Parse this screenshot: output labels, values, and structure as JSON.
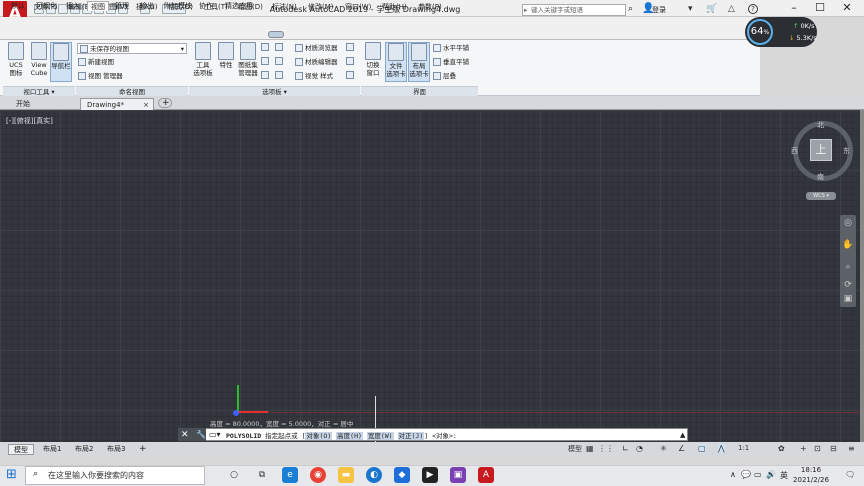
{
  "titlebar": {
    "app_letter": "A",
    "title": "Autodesk AutoCAD 2019 - 学生版    Drawing4.dwg",
    "search_placeholder": "键入关键字或短语",
    "login": "登录",
    "help": "?"
  },
  "menus": [
    "文件(F)",
    "编辑(E)",
    "视图(V)",
    "插入(I)",
    "格式(O)",
    "工具(T)",
    "绘图(D)",
    "标注(N)",
    "修改(M)",
    "窗口(W)",
    "帮助(H)",
    "参数(P)"
  ],
  "tabs": [
    "默认",
    "可视化",
    "插入",
    "视图",
    "管理",
    "输出",
    "附加模块",
    "协作",
    "精选应用"
  ],
  "active_tab": "视图",
  "ribbon": {
    "viewport_tools": {
      "title": "视口工具 ▾",
      "buttons": [
        "UCS\n图标",
        "View\nCube",
        "导航栏"
      ]
    },
    "named_views": {
      "title": "命名视图",
      "dropdown": "未保存的视图",
      "items": [
        "新建视图",
        "视图 管理器"
      ]
    },
    "palettes": {
      "title": "选项板 ▾",
      "buttons": [
        "工具\n选项板",
        "特性",
        "图纸集\n管理器"
      ],
      "items": [
        "材质浏览器",
        "材质编辑器",
        "视觉 样式"
      ]
    },
    "interface": {
      "title": "界面",
      "buttons": [
        "切换\n窗口",
        "文件\n选项卡",
        "布局\n选项卡"
      ],
      "items": [
        "水平平铺",
        "垂直平铺",
        "层叠"
      ]
    }
  },
  "perf": {
    "value": "64",
    "unit": "%",
    "up": "0K/s",
    "down": "5.3K/s"
  },
  "doc_tabs": [
    "开始",
    "Drawing4*"
  ],
  "viewport_label": "[-][俯视][真实]",
  "viewcube": {
    "north": "北",
    "south": "南",
    "west": "西",
    "east": "东",
    "face": "上",
    "wcs": "WCS ▾"
  },
  "tooltip": "高度 = 80.0000，宽度 = 5.0000，对正 = 居中",
  "command": {
    "name": "POLYSOLID",
    "prompt": "指定起点或 [",
    "opts": [
      "对象(O)",
      "高度(H)",
      "宽度(W)",
      "对正(J)"
    ],
    "tail": "] <对象>:"
  },
  "layout_tabs": [
    "模型",
    "布局1",
    "布局2",
    "布局3"
  ],
  "status": {
    "model": "模型",
    "scale": "1:1"
  },
  "taskbar": {
    "search": "在这里输入你要搜索的内容",
    "time": "18:16",
    "date": "2021/2/26",
    "ime": "英"
  },
  "colors": {
    "accent": "#c8191e",
    "canvas": "#33373d",
    "axis_x": "#e23030",
    "axis_y": "#2dbb2d"
  }
}
